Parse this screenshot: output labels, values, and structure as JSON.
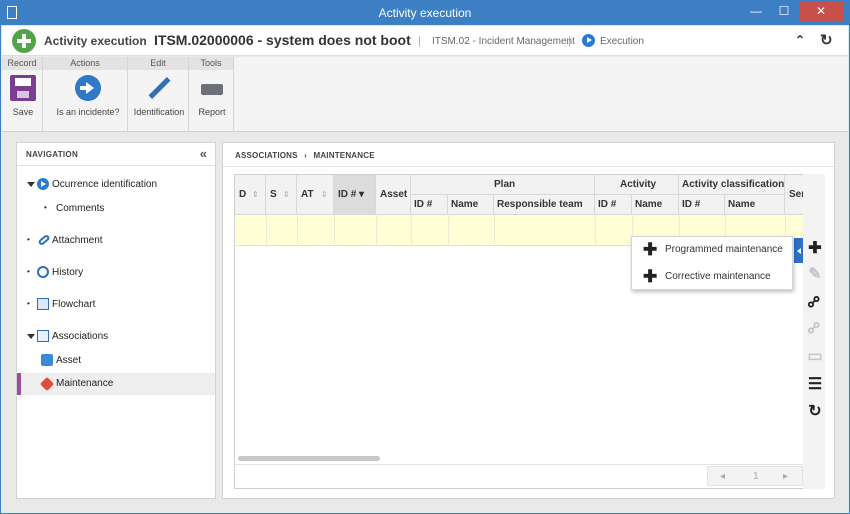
{
  "window": {
    "title": "Activity execution",
    "min": "—",
    "max": "☐",
    "close": "✕"
  },
  "header": {
    "app_name": "Activity execution",
    "record_title": "ITSM.02000006 - system does not boot",
    "process": "ITSM.02 - Incident Management",
    "status": "Execution",
    "separator": "|",
    "chevron": "›"
  },
  "ribbon": {
    "groups": [
      "Record",
      "Actions",
      "Edit",
      "Tools"
    ],
    "buttons": {
      "save": "Save",
      "is_incident": "Is an incidente?",
      "identification": "Identification",
      "report": "Report"
    }
  },
  "navigation": {
    "title": "NAVIGATION",
    "collapse_glyph": "«",
    "bullet": "•",
    "items": [
      {
        "label": "Ocurrence identification"
      },
      {
        "label": "Comments"
      },
      {
        "label": "Attachment"
      },
      {
        "label": "History"
      },
      {
        "label": "Flowchart"
      },
      {
        "label": "Associations"
      },
      {
        "label": "Asset"
      },
      {
        "label": "Maintenance"
      }
    ]
  },
  "main": {
    "breadcrumb": [
      "ASSOCIATIONS",
      "MAINTENANCE"
    ],
    "breadcrumb_sep": "›",
    "grid": {
      "columns": [
        "D",
        "S",
        "AT",
        "ID #",
        "Asset"
      ],
      "groups": [
        "Plan",
        "Activity",
        "Activity classification",
        "Ser"
      ],
      "subcolumns": [
        "ID #",
        "Name",
        "Responsible team",
        "ID #",
        "Name",
        "ID #",
        "Name"
      ],
      "sort_glyph": "⇕",
      "sorted_glyph": "▾",
      "pager": {
        "prev": "◂",
        "page": "1",
        "next": "▸"
      }
    },
    "toolbar": {
      "add": "✚",
      "edit": "✎",
      "link": "⚯",
      "unlink": "⚯",
      "view": "▭",
      "list": "☰",
      "refresh": "↻"
    }
  },
  "popup": {
    "plus_glyph": "✚",
    "items": [
      "Programmed maintenance",
      "Corrective maintenance"
    ]
  },
  "colors": {
    "titlebar": "#3c7fc4",
    "active_accent": "#9b4d9e",
    "selected_row": "#fffed5",
    "expander": "#2f6fc6"
  }
}
